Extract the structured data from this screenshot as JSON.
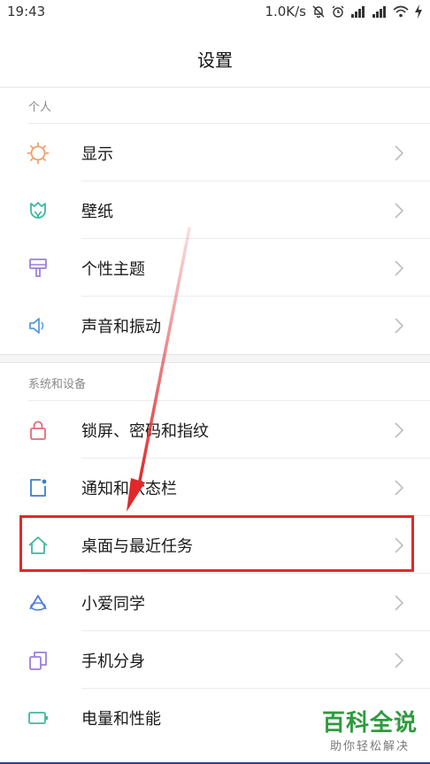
{
  "status_bar": {
    "time": "19:43",
    "speed": "1.0K/s",
    "icons": [
      "bell-off-icon",
      "alarm-icon",
      "signal-icon",
      "signal-icon",
      "wifi-icon",
      "charging-icon"
    ]
  },
  "header": {
    "title": "设置"
  },
  "sections": [
    {
      "header": "个人",
      "items": [
        {
          "label": "显示",
          "icon": "sun-icon",
          "color": "#f0a06a"
        },
        {
          "label": "壁纸",
          "icon": "tulip-icon",
          "color": "#3fb8a0"
        },
        {
          "label": "个性主题",
          "icon": "paint-brush-icon",
          "color": "#9b7fe0"
        },
        {
          "label": "声音和振动",
          "icon": "speaker-icon",
          "color": "#5a9be0"
        }
      ]
    },
    {
      "header": "系统和设备",
      "items": [
        {
          "label": "锁屏、密码和指纹",
          "icon": "lock-icon",
          "color": "#e86a7a"
        },
        {
          "label": "通知和状态栏",
          "icon": "notification-icon",
          "color": "#3a7fd0"
        },
        {
          "label": "桌面与最近任务",
          "icon": "home-icon",
          "color": "#3fb8a0"
        },
        {
          "label": "小爱同学",
          "icon": "xiaoai-icon",
          "color": "#4a7ee0"
        },
        {
          "label": "手机分身",
          "icon": "clone-icon",
          "color": "#9b7fe0"
        },
        {
          "label": "电量和性能",
          "icon": "battery-icon",
          "color": "#3fb8a0"
        }
      ]
    }
  ],
  "annotation": {
    "color": "#e0282b"
  },
  "watermark": {
    "main": "百科全说",
    "sub": "助你轻松解决"
  }
}
